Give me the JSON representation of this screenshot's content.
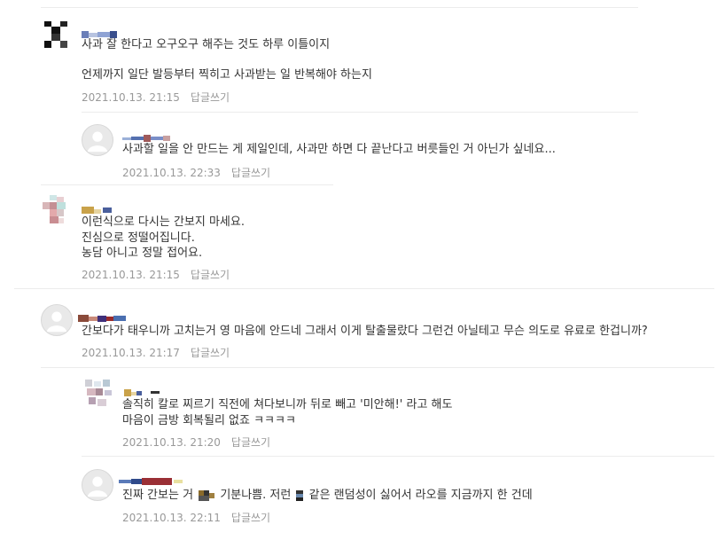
{
  "comments": [
    {
      "lines": [
        "사과 잘 한다고 오구오구 해주는 것도 하루 이틀이지",
        "",
        "언제까지 일단 발등부터 찍히고 사과받는 일 반복해야 하는지"
      ],
      "date": "2021.10.13. 21:15",
      "reply_label": "답글쓰기"
    },
    {
      "lines": [
        "사과할 일을 안 만드는 게 제일인데, 사과만 하면 다 끝난다고 버릇들인 거 아닌가 싶네요..."
      ],
      "date": "2021.10.13. 22:33",
      "reply_label": "답글쓰기"
    },
    {
      "lines": [
        "이런식으로 다시는 간보지 마세요.",
        "진심으로 정떨어집니다.",
        "농담 아니고 정말 접어요."
      ],
      "date": "2021.10.13. 21:15",
      "reply_label": "답글쓰기"
    },
    {
      "lines": [
        "간보다가 태우니까 고치는거 영 마음에 안드네 그래서 이게 탈출물랐다 그런건 아닐테고 무슨 의도로 유료로 한겁니까?"
      ],
      "date": "2021.10.13. 21:17",
      "reply_label": "답글쓰기"
    },
    {
      "lines": [
        "솔직히 칼로 찌르기 직전에 쳐다보니까 뒤로 빼고 '미안해!' 라고 해도",
        "마음이 금방 회복될리 없죠 ㅋㅋㅋㅋ"
      ],
      "date": "2021.10.13. 21:20",
      "reply_label": "답글쓰기"
    },
    {
      "line_parts": [
        "진짜 간보는 거",
        "기분나쁨. 저런",
        "같은 랜덤성이 싫어서 라오를 지금까지 한 건데"
      ],
      "date": "2021.10.13. 22:11",
      "reply_label": "답글쓰기"
    }
  ],
  "colors": {
    "text": "#333333",
    "meta": "#999999",
    "divider": "#ececec",
    "censor_blocks": "pixelated username/avatar mosaics"
  }
}
